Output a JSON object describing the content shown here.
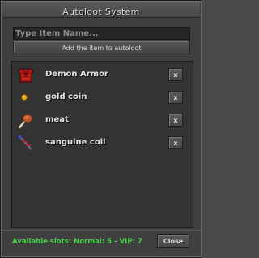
{
  "window": {
    "title": "Autoloot System"
  },
  "search": {
    "placeholder": "Type Item Name..."
  },
  "add_button": {
    "label": "Add the item to autoloot"
  },
  "items": [
    {
      "name": "Demon Armor",
      "icon": "demon-armor-icon",
      "remove_label": "x"
    },
    {
      "name": "gold coin",
      "icon": "gold-coin-icon",
      "remove_label": "x"
    },
    {
      "name": "meat",
      "icon": "meat-icon",
      "remove_label": "x"
    },
    {
      "name": "sanguine coil",
      "icon": "sanguine-coil-icon",
      "remove_label": "x"
    }
  ],
  "footer": {
    "slots_text": "Available slots: Normal: 5 - VIP: 7",
    "close_label": "Close"
  },
  "colors": {
    "window_bg": "#3f3f3f",
    "list_bg": "#333333",
    "slots_text": "#44d044"
  }
}
